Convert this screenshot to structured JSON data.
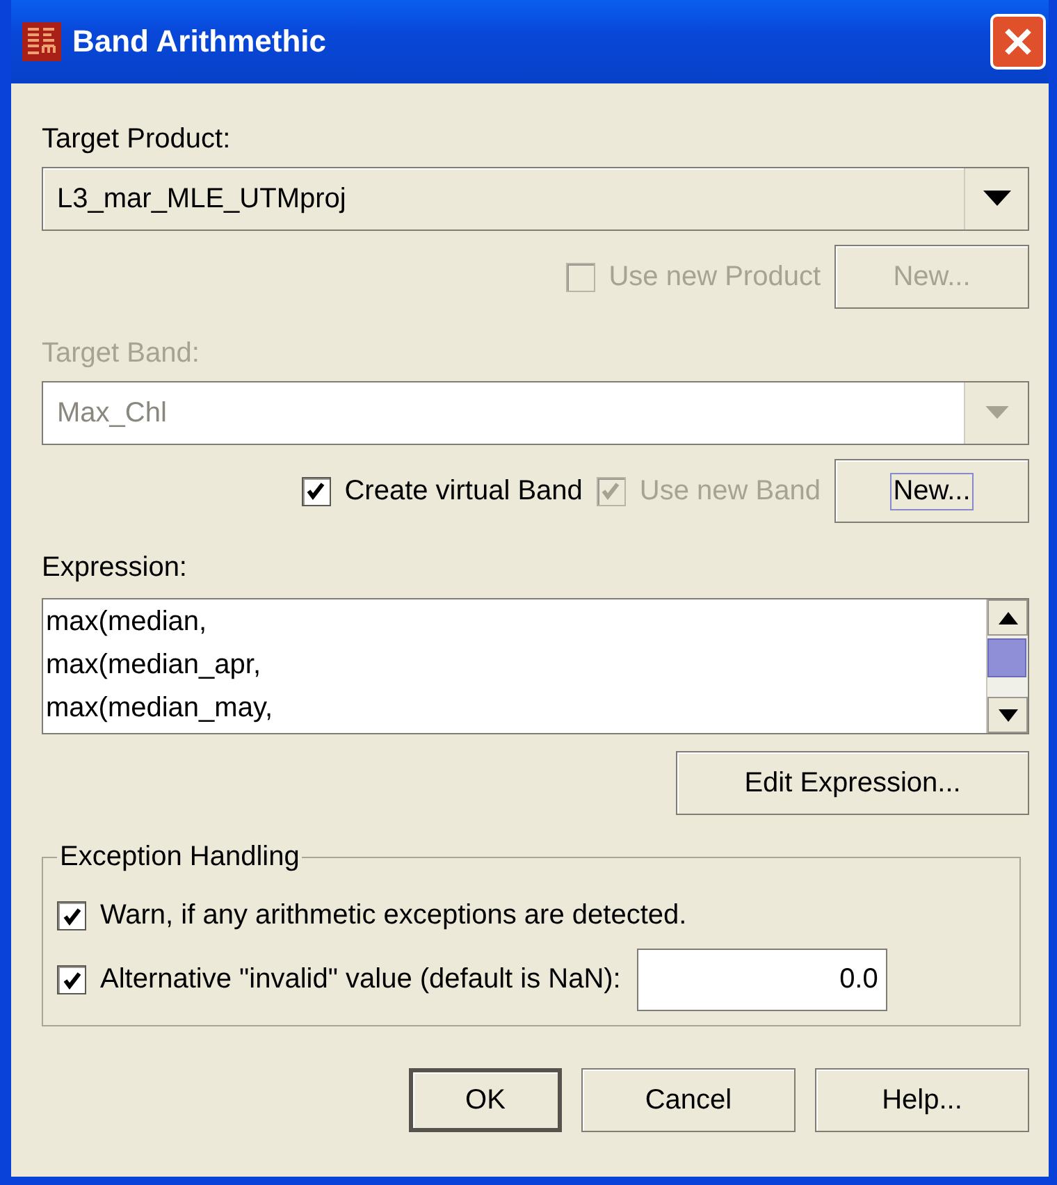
{
  "window": {
    "title": "Band Arithmethic"
  },
  "target_product": {
    "label": "Target Product:",
    "value": "L3_mar_MLE_UTMproj",
    "disabled": false
  },
  "use_new_product": {
    "label": "Use new Product",
    "checked": false,
    "disabled": true
  },
  "new_product_button": {
    "label": "New...",
    "disabled": true,
    "focused": false
  },
  "target_band": {
    "label": "Target Band:",
    "value": "Max_Chl",
    "disabled": true
  },
  "create_virtual_band": {
    "label": "Create virtual Band",
    "checked": true,
    "disabled": false
  },
  "use_new_band": {
    "label": "Use new Band",
    "checked": true,
    "disabled": true
  },
  "new_band_button": {
    "label": "New...",
    "disabled": false,
    "focused": true
  },
  "expression": {
    "label": "Expression:",
    "lines": [
      "max(median,",
      "max(median_apr,",
      "max(median_may,"
    ]
  },
  "edit_expression_button": {
    "label": "Edit Expression..."
  },
  "exception_handling": {
    "title": "Exception Handling",
    "options": [
      {
        "label": "Warn, if any arithmetic exceptions are detected.",
        "checked": true
      },
      {
        "label": "Alternative \"invalid\" value (default is NaN):",
        "checked": true
      }
    ],
    "invalid_value": "0.0"
  },
  "buttons": [
    {
      "label": "OK",
      "default": true
    },
    {
      "label": "Cancel",
      "default": false
    },
    {
      "label": "Help...",
      "default": false
    }
  ]
}
